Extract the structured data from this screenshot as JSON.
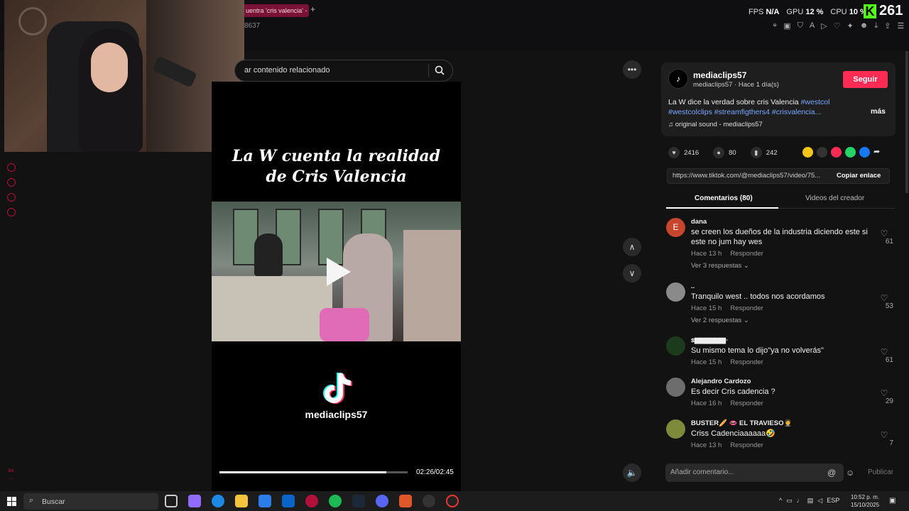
{
  "browser": {
    "tab_title": "uentra 'cris valencia' -",
    "tab_plus": "+",
    "url_fragment": "8637",
    "perf": {
      "fps_label": "FPS",
      "fps_value": "N/A",
      "gpu_label": "GPU",
      "gpu_value": "12 %",
      "cpu_label": "CPU",
      "cpu_value": "10 %"
    },
    "kick_logo": "K",
    "viewer_count": "261"
  },
  "search": {
    "text": "ar contenido relacionado",
    "icon": "search-icon"
  },
  "video": {
    "title_line1": "La W cuenta la realidad",
    "title_line2": "de Cris Valencia",
    "handle": "mediaclips57",
    "time": "02:26/02:45",
    "progress": 0.887
  },
  "controls": {
    "more": "•••",
    "up": "∧",
    "down": "∨",
    "volume": "🔈"
  },
  "post": {
    "avatar_text": "♪",
    "creator": "mediaclips57",
    "meta": "mediaclips57 · Hace 1 día(s)",
    "follow": "Seguir",
    "desc_text": "La W dice la verdad sobre cris Valencia ",
    "tag1": "#westcol",
    "tag2": "#westcolclips",
    "tag3": "#streamfigthers4",
    "tag4": "#crisvalencia...",
    "more": "más",
    "sound": "♫  original sound - mediaclips57",
    "likes": "2416",
    "comments": "80",
    "saves": "242",
    "link": "https://www.tiktok.com/@mediaclips57/video/75...",
    "copy": "Copiar enlace"
  },
  "tabs": {
    "comments": "Comentarios (80)",
    "videos": "Videos del creador"
  },
  "comments": [
    {
      "user": "dana",
      "avatar": "E",
      "avatar_color": "#c6452d",
      "text": "se creen los dueños de la industria diciendo este si este no jum hay wes",
      "time": "Hace 13 h",
      "reply": "Responder",
      "replies": "Ver 3 respuestas ⌄",
      "likes": "61"
    },
    {
      "user": "..",
      "avatar": "",
      "avatar_color": "#8a8a8a",
      "text": "Tranquilo west .. todos nos acordamos",
      "time": "Hace 15 h",
      "reply": "Responder",
      "replies": "Ver 2 respuestas ⌄",
      "likes": "53"
    },
    {
      "user": "ꜱ▆▆▆▆▆▆◦",
      "avatar": "",
      "avatar_color": "#1c3b1c",
      "text": "Su mismo tema lo dijo\"ya no volverás\"",
      "time": "Hace 15 h",
      "reply": "Responder",
      "replies": "",
      "likes": "61"
    },
    {
      "user": "Alejandro Cardozo",
      "avatar": "",
      "avatar_color": "#6d6d6d",
      "text": "Es decir Cris cadencia ?",
      "time": "Hace 16 h",
      "reply": "Responder",
      "replies": "",
      "likes": "29"
    },
    {
      "user": "BUSTER🥖 👄 EL TRAVIESO🤵",
      "avatar": "",
      "avatar_color": "#7c8a3a",
      "text": "Criss Cadenciaaaaaa🤣",
      "time": "Hace 13 h",
      "reply": "Responder",
      "replies": "",
      "likes": "7"
    }
  ],
  "composer": {
    "placeholder": "Añadir comentario...",
    "at": "@",
    "emoji": "☺",
    "publish": "Publicar"
  },
  "taskbar": {
    "search": "Buscar",
    "lang": "ESP",
    "time": "10:52 p. m.",
    "date": "15/10/2025"
  }
}
